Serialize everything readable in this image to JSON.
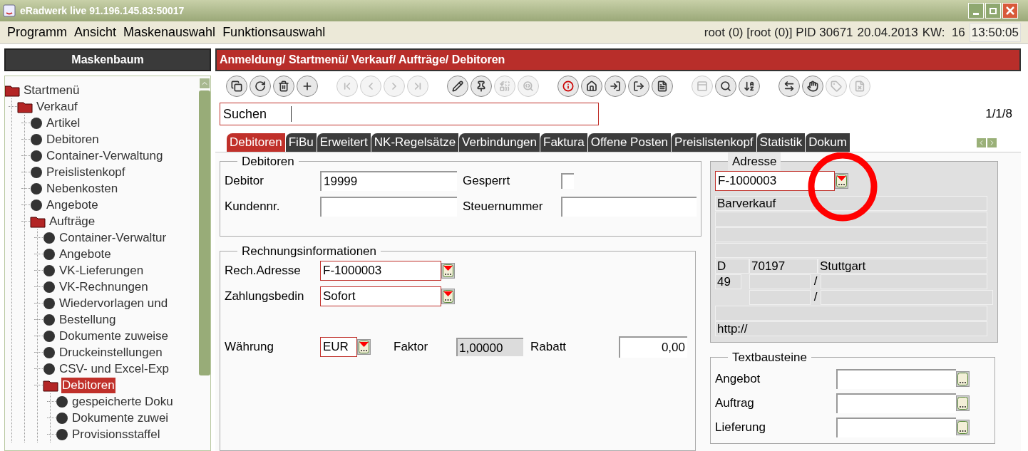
{
  "window": {
    "title": "eRadwerk live 91.196.145.83:50017"
  },
  "menu": [
    "Programm",
    "Ansicht",
    "Maskenauswahl",
    "Funktionsauswahl"
  ],
  "status": {
    "user": "root (0) [root (0)] PID 30671",
    "date": "20.04.2013",
    "week": "KW:  16",
    "time": "13:50:05"
  },
  "sidebar": {
    "title": "Maskenbaum",
    "tree": [
      {
        "label": "Startmenü",
        "kind": "folder",
        "selected": false,
        "children": [
          {
            "label": "Verkauf",
            "kind": "folder",
            "selected": false,
            "children": [
              {
                "label": "Artikel",
                "kind": "leaf",
                "selected": false
              },
              {
                "label": "Debitoren",
                "kind": "leaf",
                "selected": false
              },
              {
                "label": "Container-Verwaltung",
                "kind": "leaf",
                "selected": false
              },
              {
                "label": "Preislistenkopf",
                "kind": "leaf",
                "selected": false
              },
              {
                "label": "Nebenkosten",
                "kind": "leaf",
                "selected": false
              },
              {
                "label": "Angebote",
                "kind": "leaf",
                "selected": false
              },
              {
                "label": "Aufträge",
                "kind": "folder",
                "selected": false,
                "children": [
                  {
                    "label": "Container-Verwaltur",
                    "kind": "leaf",
                    "selected": false
                  },
                  {
                    "label": "Angebote",
                    "kind": "leaf",
                    "selected": false
                  },
                  {
                    "label": "VK-Lieferungen",
                    "kind": "leaf",
                    "selected": false
                  },
                  {
                    "label": "VK-Rechnungen",
                    "kind": "leaf",
                    "selected": false
                  },
                  {
                    "label": "Wiedervorlagen und",
                    "kind": "leaf",
                    "selected": false
                  },
                  {
                    "label": "Bestellung",
                    "kind": "leaf",
                    "selected": false
                  },
                  {
                    "label": "Dokumente zuweise",
                    "kind": "leaf",
                    "selected": false
                  },
                  {
                    "label": "Druckeinstellungen",
                    "kind": "leaf",
                    "selected": false
                  },
                  {
                    "label": "CSV- und Excel-Exp",
                    "kind": "leaf",
                    "selected": false
                  },
                  {
                    "label": "Debitoren",
                    "kind": "folder",
                    "selected": true,
                    "children": [
                      {
                        "label": "gespeicherte Doku",
                        "kind": "leaf",
                        "selected": false
                      },
                      {
                        "label": "Dokumente zuwei",
                        "kind": "leaf",
                        "selected": false
                      },
                      {
                        "label": "Provisionsstaffel",
                        "kind": "leaf",
                        "selected": false
                      }
                    ]
                  }
                ]
              }
            ]
          }
        ]
      }
    ]
  },
  "breadcrumb": "Anmeldung/ Startmenü/ Verkauf/ Aufträge/ Debitoren",
  "toolbar": [
    {
      "disabled": false
    },
    {
      "disabled": false
    },
    {
      "disabled": false
    },
    {
      "disabled": false
    },
    {
      "disabled": true
    },
    {
      "disabled": true
    },
    {
      "disabled": true
    },
    {
      "disabled": true
    },
    {
      "disabled": false
    },
    {
      "disabled": false
    },
    {
      "disabled": true
    },
    {
      "disabled": true
    },
    {
      "disabled": false
    },
    {
      "disabled": false
    },
    {
      "disabled": false
    },
    {
      "disabled": false
    },
    {
      "disabled": false
    },
    {
      "disabled": true
    },
    {
      "disabled": false
    },
    {
      "disabled": false
    },
    {
      "disabled": false
    },
    {
      "disabled": false
    },
    {
      "disabled": true
    },
    {
      "disabled": true
    }
  ],
  "search": {
    "label": "Suchen",
    "counter": "1/1/8"
  },
  "tabs": [
    {
      "label": "Debitoren",
      "selected": true
    },
    {
      "label": "FiBu",
      "selected": false
    },
    {
      "label": "Erweitert",
      "selected": false
    },
    {
      "label": "NK-Regelsätze",
      "selected": false
    },
    {
      "label": "Verbindungen",
      "selected": false
    },
    {
      "label": "Faktura",
      "selected": false
    },
    {
      "label": "Offene Posten",
      "selected": false
    },
    {
      "label": "Preislistenkopf",
      "selected": false
    },
    {
      "label": "Statistik",
      "selected": false
    },
    {
      "label": "Dokum",
      "selected": false
    }
  ],
  "debitoren": {
    "title": "Debitoren",
    "debitor": {
      "label": "Debitor",
      "value": "19999"
    },
    "gesperrt": {
      "label": "Gesperrt",
      "checked": false
    },
    "kundennr": {
      "label": "Kundennr."
    },
    "steuernummer": {
      "label": "Steuernummer"
    }
  },
  "rechnung": {
    "title": "Rechnungsinformationen",
    "adresse": {
      "label": "Rech.Adresse",
      "value": "F-1000003"
    },
    "zahlung": {
      "label": "Zahlungsbedin",
      "value": "Sofort"
    },
    "waehrung": {
      "label": "Währung",
      "value": "EUR"
    },
    "faktor": {
      "label": "Faktor",
      "value": "1,00000"
    },
    "rabatt": {
      "label": "Rabatt",
      "value": "0,00"
    }
  },
  "adresse": {
    "title": "Adresse",
    "value": "F-1000003",
    "name": "Barverkauf",
    "country": "D",
    "zip": "70197",
    "city": "Stuttgart",
    "phone_prefix": "49",
    "separator_1": "/",
    "separator_2": "/",
    "web": "http://"
  },
  "annotations": [
    {
      "kind": "circle"
    }
  ],
  "textbausteine": {
    "title": "Textbausteine",
    "rows": [
      {
        "label": "Angebot"
      },
      {
        "label": "Auftrag"
      },
      {
        "label": "Lieferung"
      }
    ]
  }
}
